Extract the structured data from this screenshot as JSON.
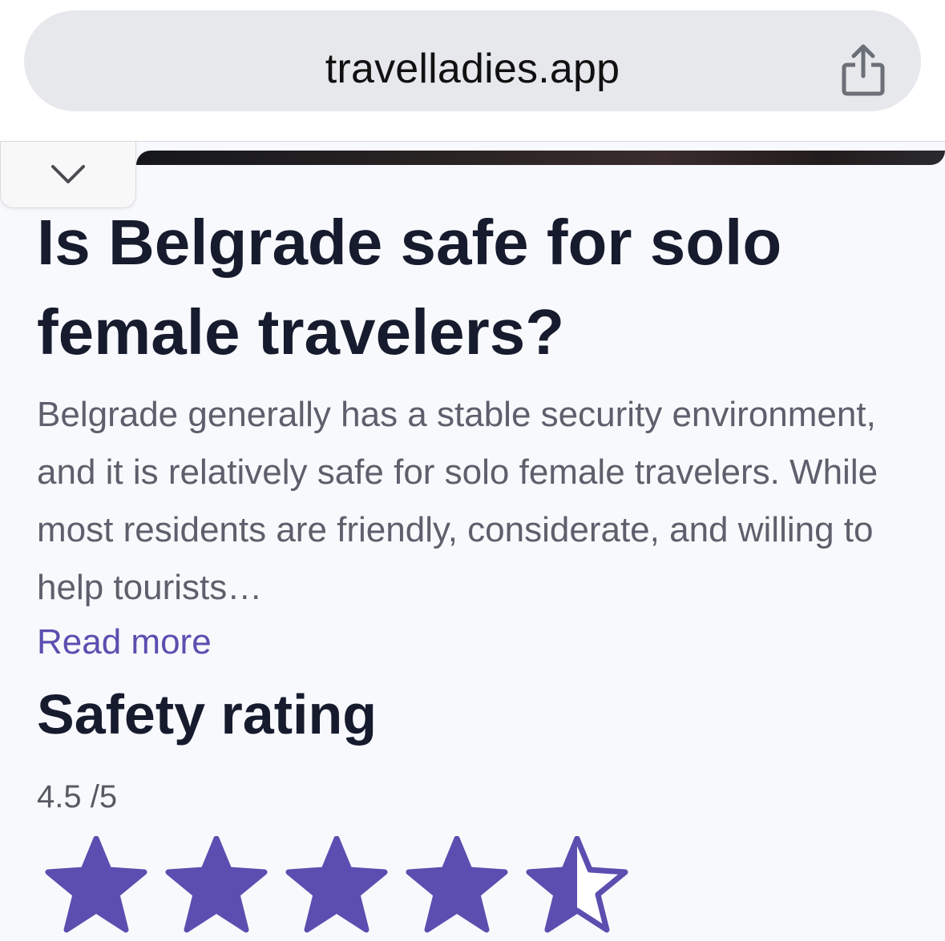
{
  "browser": {
    "url": "travelladies.app",
    "share_icon": "share-icon"
  },
  "page": {
    "collapse_icon": "chevron-down-icon",
    "title": "Is Belgrade safe for solo female travelers?",
    "description": "Belgrade generally has a stable security environment, and it is relatively safe for solo female travelers. While most residents are friendly, considerate, and willing to help tourists…",
    "read_more_label": "Read more",
    "safety_section_title": "Safety rating",
    "rating_text": "4.5 /5",
    "rating_value": 4.5,
    "rating_max": 5,
    "star_color": "#5a4fb0"
  }
}
